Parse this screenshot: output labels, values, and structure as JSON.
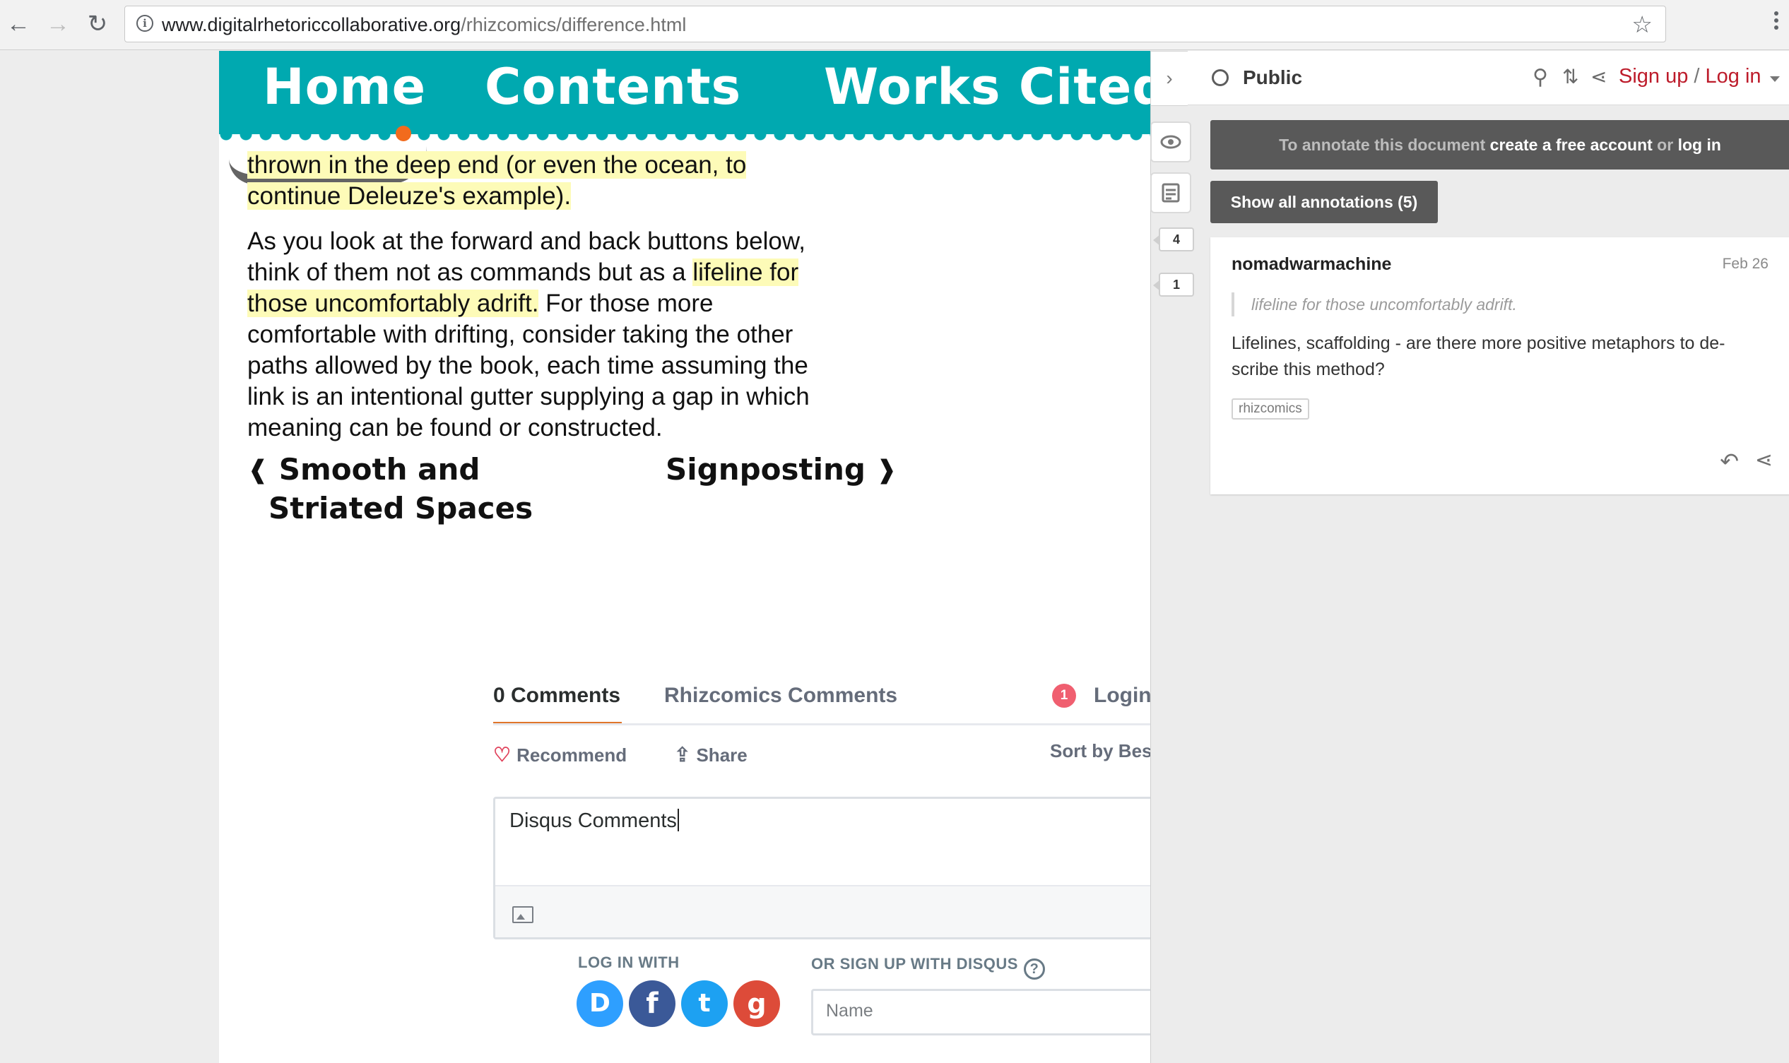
{
  "browser": {
    "url_domain": "www.digitalrhetoriccollaborative.org",
    "url_path": "/rhizcomics/difference.html"
  },
  "site_nav": {
    "home": "Home",
    "contents": "Contents",
    "works_cited": "Works Cited"
  },
  "article": {
    "p1_hl": "thrown in the deep end (or even the ocean, to continue Deleuze's example).",
    "p2_a": "As you look at the forward and back buttons below, think of them not as commands but as a ",
    "p2_hl": "lifeline for those uncomfortably adrift.",
    "p2_b": " For those more comfortable with drifting, consider taking the other paths allowed by the book, each time assuming the link is an intentional gutter supplying a gap in which meaning can be found or constructed."
  },
  "pager": {
    "prev_line1": "Smooth and",
    "prev_line2": "Striated Spaces",
    "next": "Signposting"
  },
  "disqus": {
    "tab_comments": "0 Comments",
    "tab_site": "Rhizcomics Comments",
    "notif_count": "1",
    "login": "Login",
    "recommend": "Recommend",
    "share": "Share",
    "sort": "Sort by Best",
    "draft_text": "Disqus Comments",
    "login_with": "LOG IN WITH",
    "signup_with": "OR SIGN UP WITH DISQUS",
    "name_placeholder": "Name",
    "social": [
      "D",
      "f",
      "t",
      "g"
    ]
  },
  "hypothesis": {
    "group": "Public",
    "sign_up": "Sign up",
    "separator": "/",
    "log_in": "Log in",
    "banner_a": "To annotate this document ",
    "banner_b": "create a free account",
    "banner_c": " or ",
    "banner_d": "log in",
    "show_all": "Show all annotations (5)",
    "bucket_top": "4",
    "bucket_bottom": "1",
    "annotation": {
      "user": "nomadwarmachine",
      "date": "Feb 26",
      "quote": "lifeline for those uncomfortably adrift.",
      "body": "Lifelines, scaffolding - are there more positive metaphors to de-scribe this method?",
      "tag": "rhizcomics"
    }
  },
  "colors": {
    "teal": "#00a9b0",
    "highlight": "#fdfbb8",
    "hypothesis_red": "#bd1c2b",
    "disqus_orange": "#e0762b"
  }
}
